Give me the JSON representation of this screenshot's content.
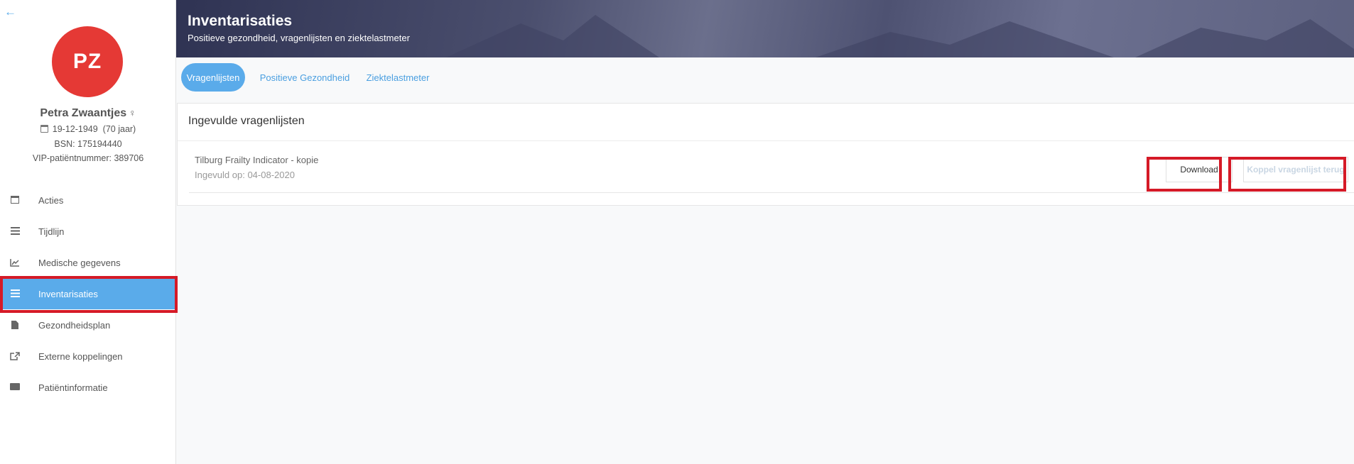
{
  "sidebar": {
    "patient": {
      "initials": "PZ",
      "name": "Petra Zwaantjes",
      "gender_symbol": "♀",
      "birthdate": "19-12-1949",
      "age": "(70 jaar)",
      "bsn": "BSN: 175194440",
      "vip_number": "VIP-patiëntnummer: 389706",
      "avatar_color": "#e53935"
    },
    "nav": [
      {
        "label": "Acties",
        "icon": "calendar-plus-icon"
      },
      {
        "label": "Tijdlijn",
        "icon": "list-icon"
      },
      {
        "label": "Medische gegevens",
        "icon": "line-chart-icon"
      },
      {
        "label": "Inventarisaties",
        "icon": "list-ol-icon",
        "active": true
      },
      {
        "label": "Gezondheidsplan",
        "icon": "document-icon"
      },
      {
        "label": "Externe koppelingen",
        "icon": "external-link-icon"
      },
      {
        "label": "Patiëntinformatie",
        "icon": "id-card-icon"
      }
    ]
  },
  "header": {
    "title": "Inventarisaties",
    "subtitle": "Positieve gezondheid, vragenlijsten en ziektelastmeter"
  },
  "tabs": [
    {
      "label": "Vragenlijsten",
      "active": true
    },
    {
      "label": "Positieve Gezondheid",
      "active": false
    },
    {
      "label": "Ziektelastmeter",
      "active": false
    }
  ],
  "card": {
    "title": "Ingevulde vragenlijsten",
    "rows": [
      {
        "title": "Tilburg Frailty Indicator - kopie",
        "date": "Ingevuld op: 04-08-2020",
        "download_label": "Download",
        "koppel_label": "Koppel vragenlijst terug"
      }
    ]
  },
  "colors": {
    "accent": "#5aabea",
    "highlight": "#d51a27"
  }
}
